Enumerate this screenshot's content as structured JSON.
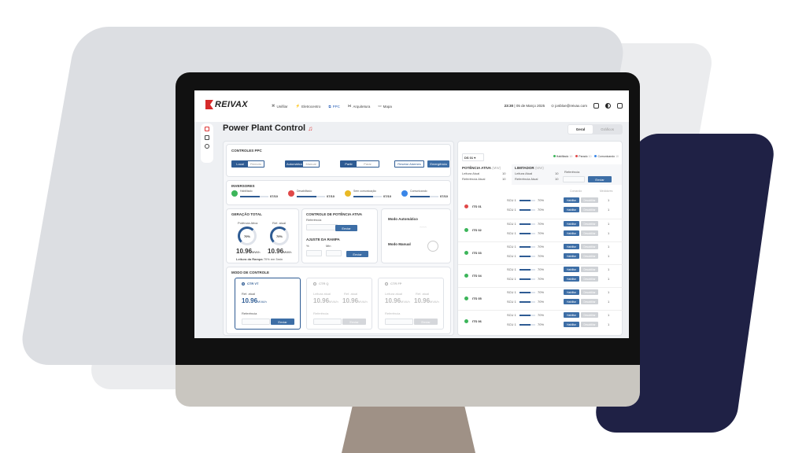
{
  "app": {
    "logo": "REIVAX",
    "time": "23:30",
    "date": "05 de Março 2025",
    "user": "jonbloe@reivax.com"
  },
  "nav": [
    {
      "label": "Unifilar"
    },
    {
      "label": "Eletrocentro"
    },
    {
      "label": "PPC"
    },
    {
      "label": "Arquitetura"
    },
    {
      "label": "Mapa"
    }
  ],
  "page": {
    "title": "Power Plant Control",
    "tab_geral": "Geral",
    "tab_graficos": "Gráficos"
  },
  "controles": {
    "title": "CONTROLES PPC",
    "local": "Local",
    "remoto": "Remoto",
    "auto": "Automático",
    "manual": "Manual",
    "partir": "Partir",
    "parar": "Parar",
    "resetar": "Resetar Alarmes",
    "emergencia": "Emergência"
  },
  "inversores": {
    "title": "INVERSORES",
    "items": [
      {
        "label": "Habilitado",
        "count": "07/10",
        "color": "#3cb55a",
        "fill": 0.7
      },
      {
        "label": "Desabilitado",
        "count": "07/10",
        "color": "#e04848",
        "fill": 0.7
      },
      {
        "label": "Sem comunicação",
        "count": "07/10",
        "color": "#e9b925",
        "fill": 0.7
      },
      {
        "label": "Comunicando",
        "count": "07/10",
        "color": "#3a86e8",
        "fill": 0.7
      }
    ]
  },
  "geracao": {
    "title": "GERAÇÃO TOTAL",
    "pot_label": "Potência Ativa",
    "ref_label": "Ref. atual",
    "pot_pct": "70%",
    "ref_pct": "70%",
    "pot_val": "10.96",
    "pot_unit": "MW/h",
    "ref_val": "10.96",
    "ref_unit": "MW/h",
    "rampa_label": "Leitura da Rampa",
    "rampa_val": "70% em 5min"
  },
  "potencia": {
    "title": "CONTROLE DE POTÊNCIA ATIVA",
    "ref": "Referência",
    "enviar": "Enviar",
    "rampa_title": "AJUSTE DA RAMPA",
    "pct": "%",
    "min": "Min",
    "enviar2": "Enviar"
  },
  "modo": {
    "auto": "Modo Automático",
    "manual": "Modo Manual",
    "tiny1": "Operação",
    "tiny2": "Válido",
    "tiny3": "Parado",
    "tiny4": "Aguardando",
    "tiny5": "Falha",
    "tiny6": "Normal"
  },
  "modo_controle": {
    "title": "MODO DE CONTROLE",
    "cards": [
      {
        "name": "CTR VT",
        "active": true,
        "l1": "Ref. atual",
        "v1": "10.96",
        "u1": "MVA/h",
        "l2": "",
        "v2": "",
        "u2": "",
        "ref": "Referência",
        "btn": "Enviar"
      },
      {
        "name": "CTR Q",
        "active": false,
        "l1": "Leitura atual",
        "v1": "10.96",
        "u1": "MVA/h",
        "l2": "Ref. atual",
        "v2": "10.96",
        "u2": "MVA/h",
        "ref": "Referência",
        "btn": "Enviar"
      },
      {
        "name": "CTR FP",
        "active": false,
        "l1": "Leitura atual",
        "v1": "10.96",
        "u1": "MVA/h",
        "l2": "Ref. atual",
        "v2": "10.96",
        "u2": "MVA/h",
        "ref": "Referência",
        "btn": "Enviar"
      }
    ]
  },
  "right": {
    "ds": "DS 01",
    "leg": [
      {
        "label": "Habilitado",
        "n": "10",
        "color": "#3cb55a"
      },
      {
        "label": "Parado",
        "n": "10",
        "color": "#e04848"
      },
      {
        "label": "Comunicando",
        "n": "10",
        "color": "#3a86e8"
      }
    ],
    "pot_title": "POTÊNCIA ATIVA",
    "pot_unit": "(MW)",
    "leitura": "Leitura Atual",
    "ref_atual": "Referência Atual",
    "v": "10",
    "lim_title": "LIMITADOR",
    "lim_unit": "(MW)",
    "referencia": "Referência",
    "enviar": "Enviar",
    "col_com": "Comando",
    "col_med": "Medidores",
    "its": [
      {
        "name": "ITS 01",
        "color": "#e04848"
      },
      {
        "name": "ITS 02",
        "color": "#3cb55a"
      },
      {
        "name": "ITS 03",
        "color": "#3cb55a"
      },
      {
        "name": "ITS 04",
        "color": "#3cb55a"
      },
      {
        "name": "ITS 05",
        "color": "#3cb55a"
      },
      {
        "name": "ITS 06",
        "color": "#3cb55a"
      }
    ],
    "scu": "SCU 1",
    "pct": "70%",
    "hab": "Habilitar",
    "des": "Desabilitar",
    "med": "1"
  }
}
